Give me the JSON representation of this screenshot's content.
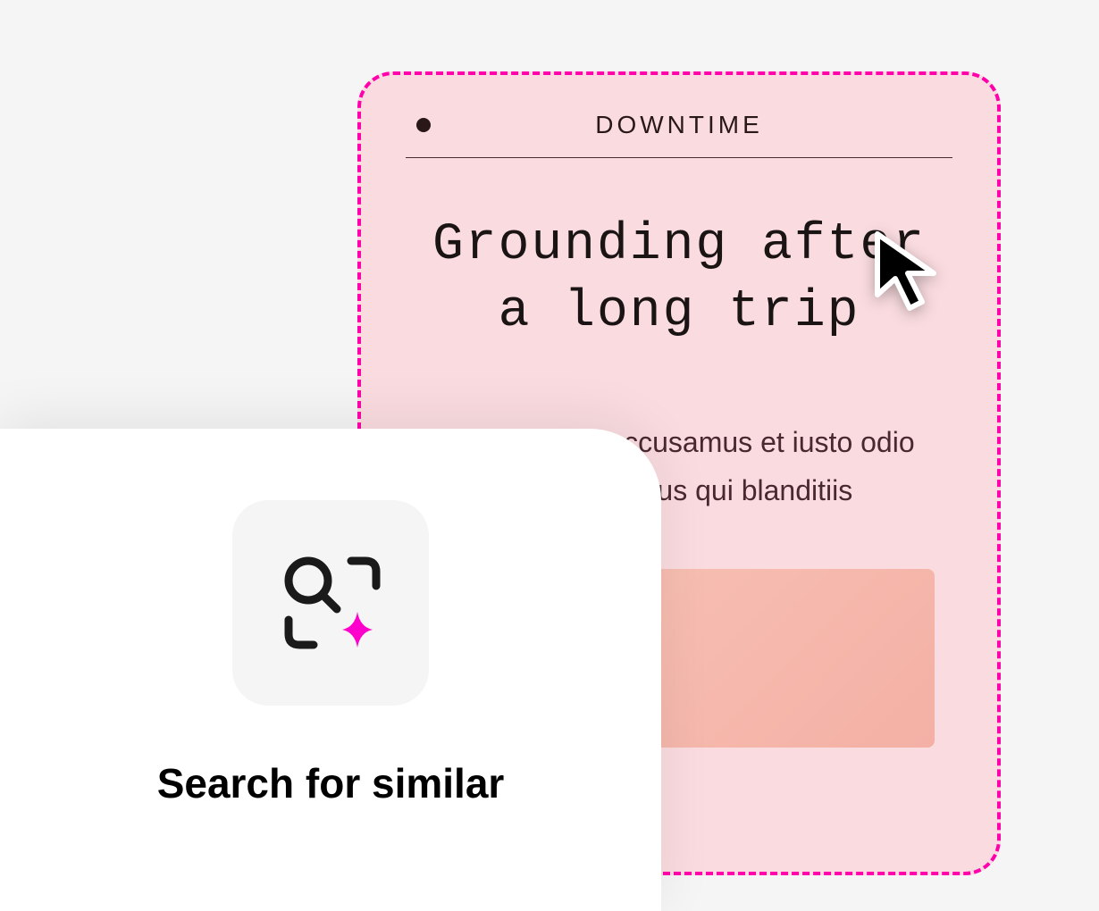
{
  "card": {
    "category": "DOWNTIME",
    "title": "Grounding after a long trip",
    "body": "At vero eos et accusamus et iusto odio dignissimos ducimus qui blanditiis"
  },
  "overlay": {
    "action_label": "Search for similar"
  },
  "colors": {
    "selection": "#ff00aa",
    "card_bg": "#fadce0",
    "accent": "#ff00aa"
  }
}
